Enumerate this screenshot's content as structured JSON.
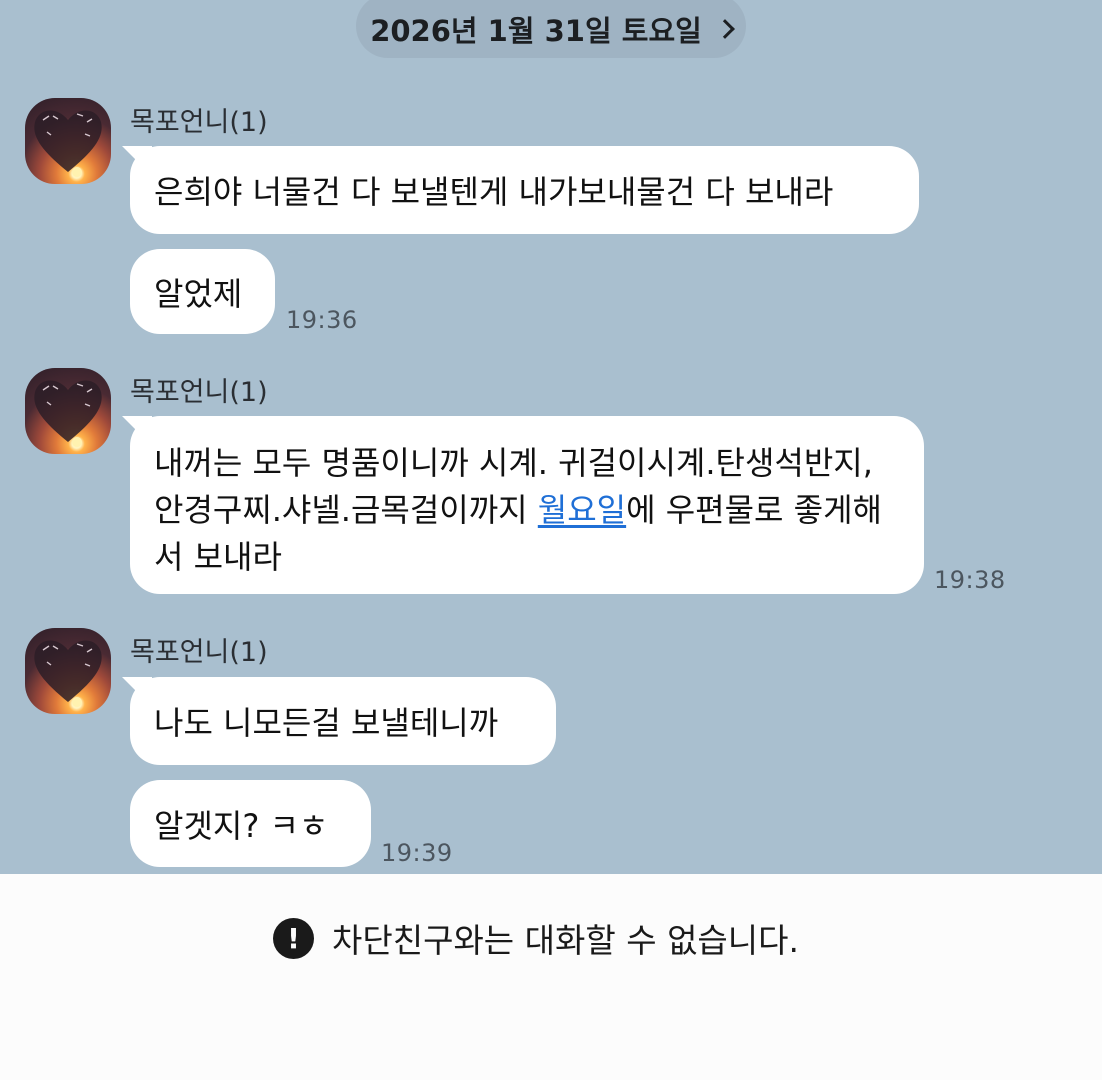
{
  "date_chip": {
    "label": "2026년 1월 31일 토요일"
  },
  "messages": [
    {
      "sender": "목포언니(1)",
      "bubbles": [
        "은희야 너물건 다 보낼텐게 내가보내물건 다 보내라",
        "알었제"
      ],
      "time": "19:36"
    },
    {
      "sender": "목포언니(1)",
      "text_before": "내꺼는 모두 명품이니까 시계. 귀걸이시계.탄생석반지, 안경구찌.샤넬.금목걸이까지 ",
      "link": "월요일",
      "text_after": "에 우편물로 좋게해서 보내라",
      "time": "19:38"
    },
    {
      "sender": "목포언니(1)",
      "bubbles": [
        "나도 니모든걸 보낼테니까",
        "알겟지? ㅋㅎ"
      ],
      "time": "19:39"
    }
  ],
  "notice": {
    "icon": "exclamation-circle-icon",
    "text": "차단친구와는 대화할 수 없습니다."
  },
  "colors": {
    "chat_background": "#a9bfcf",
    "bubble": "#ffffff",
    "link": "#1f6fd6"
  }
}
